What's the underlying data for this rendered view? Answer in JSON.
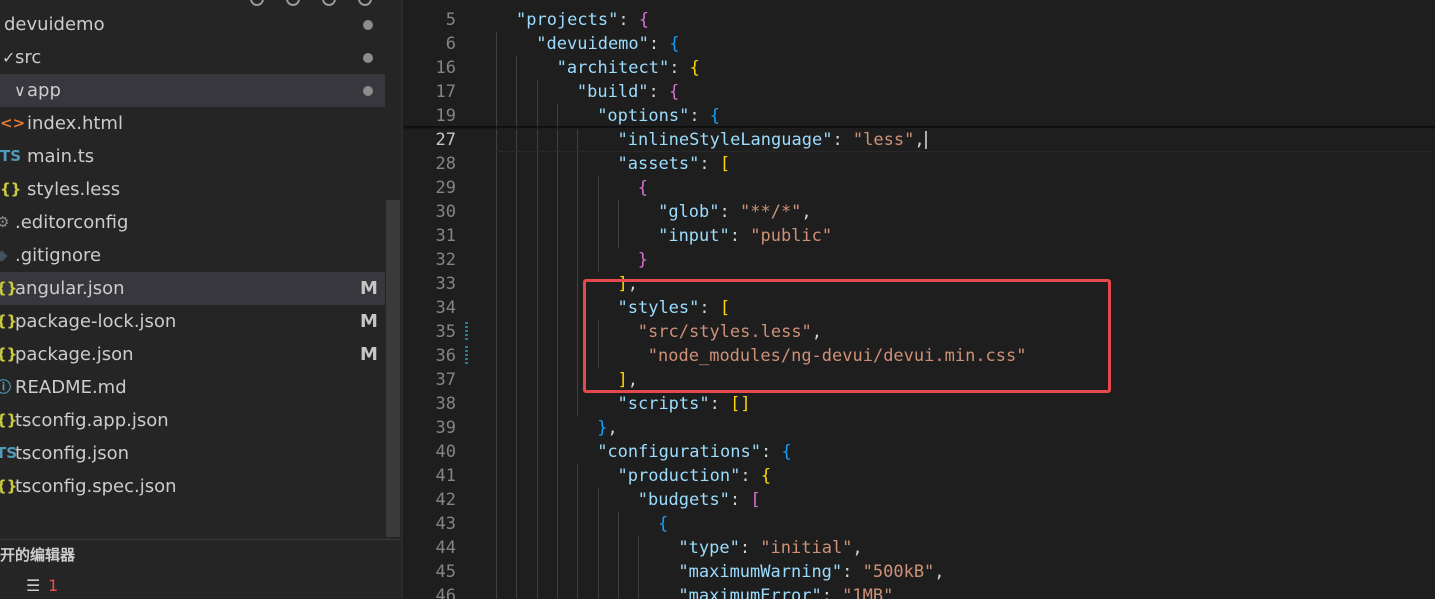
{
  "sidebar": {
    "items": [
      {
        "label": "devuidemo",
        "icon": "",
        "indent": 4,
        "chevron": "",
        "status": "dot"
      },
      {
        "label": "src",
        "icon": "",
        "indent": 15,
        "chevron": "✓",
        "status": "dot"
      },
      {
        "label": "app",
        "icon": "",
        "indent": 27,
        "chevron": "∨",
        "status": "dot",
        "active": true
      },
      {
        "label": "index.html",
        "icon": "<>",
        "indent": 27,
        "chevron": "",
        "status": ""
      },
      {
        "label": "main.ts",
        "icon": "TS",
        "indent": 27,
        "chevron": "",
        "status": ""
      },
      {
        "label": "styles.less",
        "icon": "{}",
        "indent": 27,
        "chevron": "",
        "status": ""
      },
      {
        "label": ".editorconfig",
        "icon": "⚙",
        "indent": 15,
        "chevron": "",
        "status": ""
      },
      {
        "label": ".gitignore",
        "icon": "◆",
        "indent": 15,
        "chevron": "",
        "status": ""
      },
      {
        "label": "angular.json",
        "icon": "{}",
        "indent": 15,
        "chevron": "",
        "status": "M",
        "selected": true
      },
      {
        "label": "package-lock.json",
        "icon": "{}",
        "indent": 15,
        "chevron": "",
        "status": "M"
      },
      {
        "label": "package.json",
        "icon": "{}",
        "indent": 15,
        "chevron": "",
        "status": "M"
      },
      {
        "label": "README.md",
        "icon": "ⓘ",
        "indent": 15,
        "chevron": "",
        "status": ""
      },
      {
        "label": "tsconfig.app.json",
        "icon": "{}",
        "indent": 15,
        "chevron": "",
        "status": ""
      },
      {
        "label": "tsconfig.json",
        "icon": "TS",
        "indent": 15,
        "chevron": "",
        "status": ""
      },
      {
        "label": "tsconfig.spec.json",
        "icon": "{}",
        "indent": 15,
        "chevron": "",
        "status": ""
      }
    ],
    "open_editors_header": "开的编辑器",
    "open_editor_count": "1"
  },
  "editor": {
    "top_text": "                                                 ",
    "lines": [
      {
        "n": "5",
        "depth": 0,
        "tokens": [
          [
            "k",
            "\"projects\""
          ],
          [
            "p",
            ": "
          ],
          [
            "b2",
            "{"
          ]
        ]
      },
      {
        "n": "6",
        "depth": 1,
        "tokens": [
          [
            "k",
            "\"devuidemo\""
          ],
          [
            "p",
            ": "
          ],
          [
            "b3",
            "{"
          ]
        ]
      },
      {
        "n": "16",
        "depth": 2,
        "tokens": [
          [
            "k",
            "\"architect\""
          ],
          [
            "p",
            ": "
          ],
          [
            "b1",
            "{"
          ]
        ]
      },
      {
        "n": "17",
        "depth": 3,
        "tokens": [
          [
            "k",
            "\"build\""
          ],
          [
            "p",
            ": "
          ],
          [
            "b2",
            "{"
          ]
        ]
      },
      {
        "n": "19",
        "depth": 4,
        "tokens": [
          [
            "k",
            "\"options\""
          ],
          [
            "p",
            ": "
          ],
          [
            "b3",
            "{"
          ]
        ]
      },
      {
        "n": "27",
        "depth": 5,
        "current": true,
        "tokens": [
          [
            "k",
            "\"inlineStyleLanguage\""
          ],
          [
            "p",
            ": "
          ],
          [
            "s",
            "\"less\""
          ],
          [
            "p",
            ","
          ],
          [
            "cursor",
            ""
          ]
        ]
      },
      {
        "n": "28",
        "depth": 5,
        "tokens": [
          [
            "k",
            "\"assets\""
          ],
          [
            "p",
            ": "
          ],
          [
            "b1",
            "["
          ]
        ]
      },
      {
        "n": "29",
        "depth": 6,
        "tokens": [
          [
            "b2",
            "{"
          ]
        ]
      },
      {
        "n": "30",
        "depth": 7,
        "tokens": [
          [
            "k",
            "\"glob\""
          ],
          [
            "p",
            ": "
          ],
          [
            "s",
            "\"**/*\""
          ],
          [
            "p",
            ","
          ]
        ]
      },
      {
        "n": "31",
        "depth": 7,
        "tokens": [
          [
            "k",
            "\"input\""
          ],
          [
            "p",
            ": "
          ],
          [
            "s",
            "\"public\""
          ]
        ]
      },
      {
        "n": "32",
        "depth": 6,
        "tokens": [
          [
            "b2",
            "}"
          ]
        ]
      },
      {
        "n": "33",
        "depth": 5,
        "tokens": [
          [
            "b1",
            "]"
          ],
          [
            "p",
            ","
          ]
        ]
      },
      {
        "n": "34",
        "depth": 5,
        "tokens": [
          [
            "k",
            "\"styles\""
          ],
          [
            "p",
            ": "
          ],
          [
            "b1",
            "["
          ]
        ]
      },
      {
        "n": "35",
        "depth": 6,
        "mod": true,
        "tokens": [
          [
            "s",
            "\"src/styles.less\""
          ],
          [
            "p",
            ","
          ]
        ]
      },
      {
        "n": "36",
        "depth": 6,
        "mod": true,
        "extra": 10,
        "tokens": [
          [
            "s",
            "\"node_modules/ng-devui/devui.min.css\""
          ]
        ]
      },
      {
        "n": "37",
        "depth": 5,
        "tokens": [
          [
            "b1",
            "]"
          ],
          [
            "p",
            ","
          ]
        ]
      },
      {
        "n": "38",
        "depth": 5,
        "tokens": [
          [
            "k",
            "\"scripts\""
          ],
          [
            "p",
            ": "
          ],
          [
            "b1",
            "[]"
          ]
        ]
      },
      {
        "n": "39",
        "depth": 4,
        "tokens": [
          [
            "b3",
            "}"
          ],
          [
            "p",
            ","
          ]
        ]
      },
      {
        "n": "40",
        "depth": 4,
        "tokens": [
          [
            "k",
            "\"configurations\""
          ],
          [
            "p",
            ": "
          ],
          [
            "b3",
            "{"
          ]
        ]
      },
      {
        "n": "41",
        "depth": 5,
        "tokens": [
          [
            "k",
            "\"production\""
          ],
          [
            "p",
            ": "
          ],
          [
            "b1",
            "{"
          ]
        ]
      },
      {
        "n": "42",
        "depth": 6,
        "tokens": [
          [
            "k",
            "\"budgets\""
          ],
          [
            "p",
            ": "
          ],
          [
            "b2",
            "["
          ]
        ]
      },
      {
        "n": "43",
        "depth": 7,
        "tokens": [
          [
            "b3",
            "{"
          ]
        ]
      },
      {
        "n": "44",
        "depth": 8,
        "tokens": [
          [
            "k",
            "\"type\""
          ],
          [
            "p",
            ": "
          ],
          [
            "s",
            "\"initial\""
          ],
          [
            "p",
            ","
          ]
        ]
      },
      {
        "n": "45",
        "depth": 8,
        "tokens": [
          [
            "k",
            "\"maximumWarning\""
          ],
          [
            "p",
            ": "
          ],
          [
            "s",
            "\"500kB\""
          ],
          [
            "p",
            ","
          ]
        ]
      },
      {
        "n": "46",
        "depth": 8,
        "tokens": [
          [
            "k",
            "\"maximumError\""
          ],
          [
            "p",
            ": "
          ],
          [
            "s",
            "\"1MB\""
          ]
        ]
      }
    ]
  },
  "colors": {
    "sidebar_bg": "#252526",
    "editor_bg": "#1e1e1e",
    "highlight_box": "#e5484d",
    "json_key": "#9cdcfe",
    "json_string": "#ce9178"
  }
}
